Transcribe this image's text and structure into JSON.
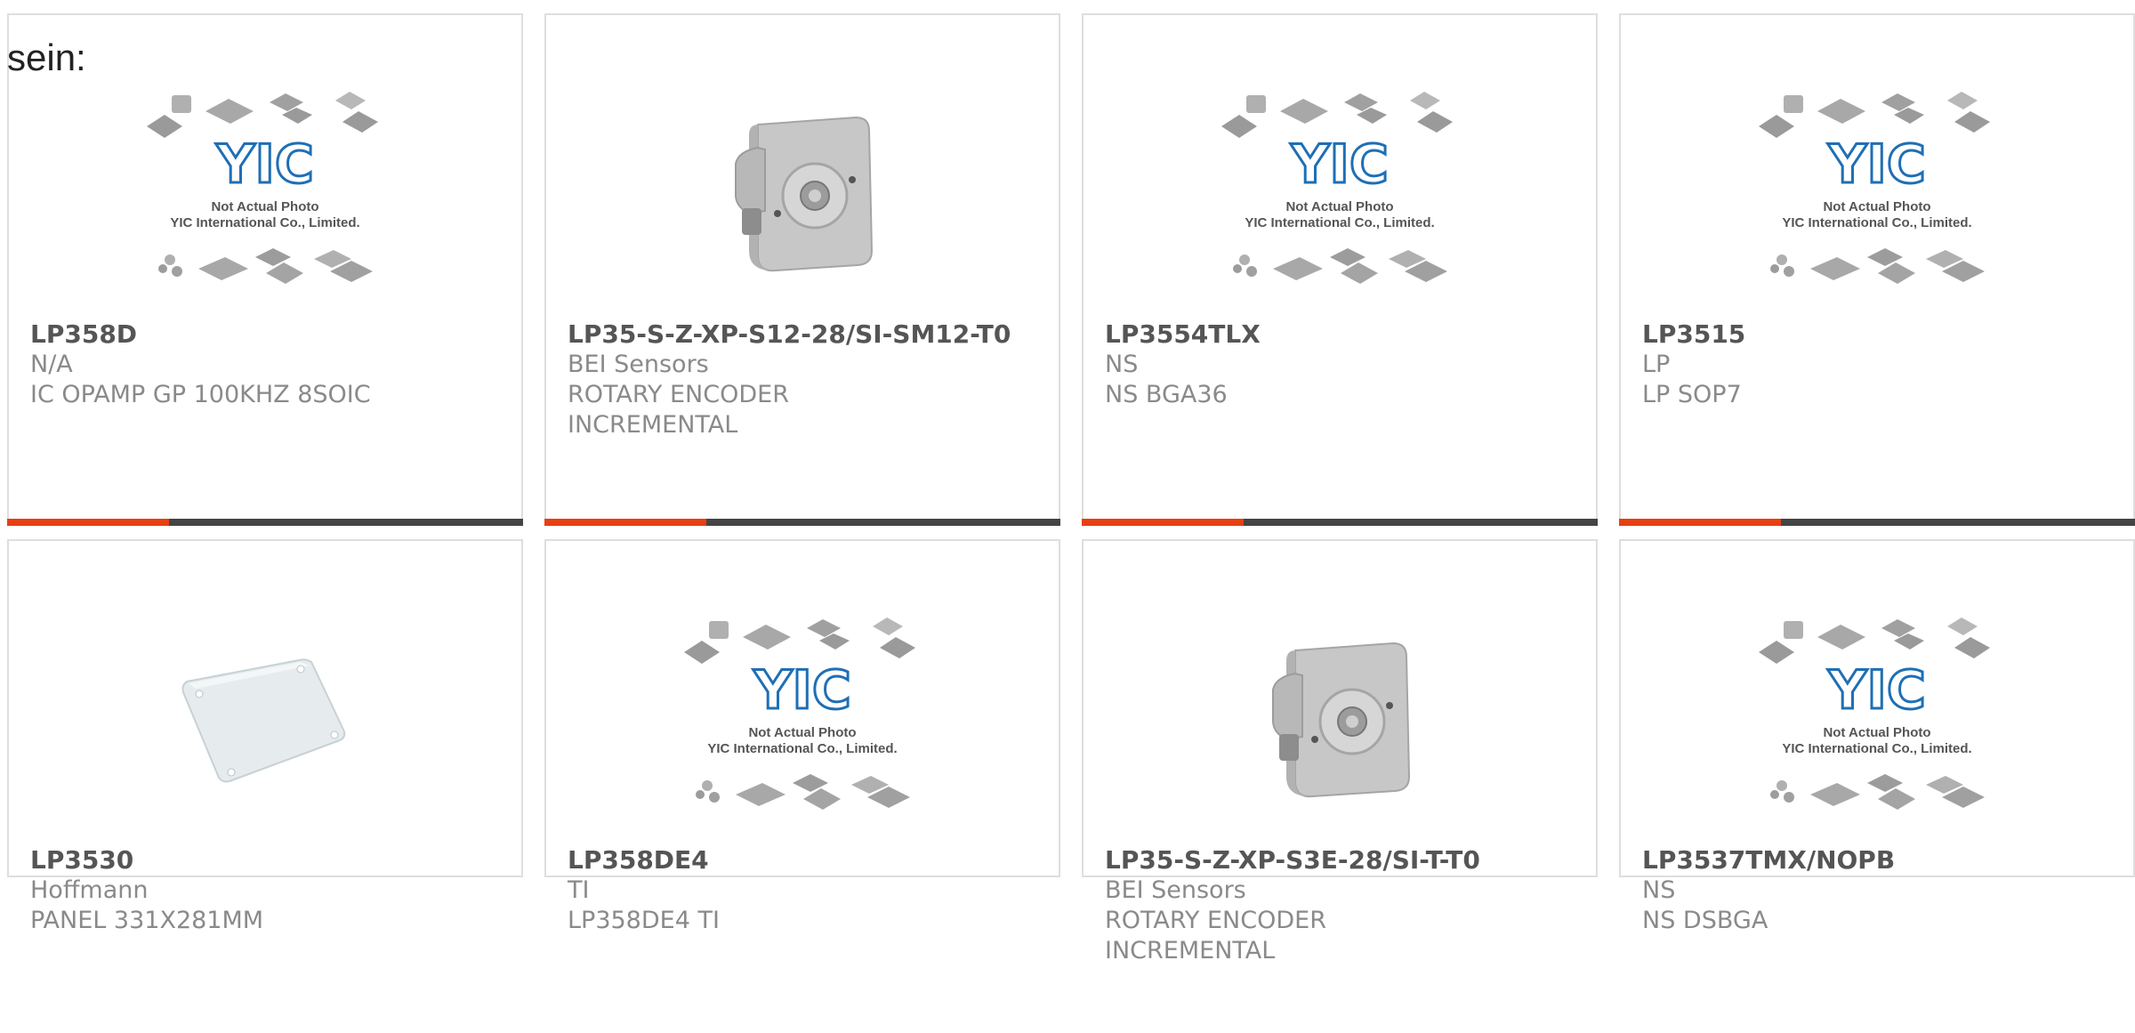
{
  "intro_text": "sein:",
  "colors": {
    "accent": "#e63f12",
    "bar": "#444444",
    "border": "#dedede",
    "part_number": "#555555",
    "secondary_text": "#8a8a8a",
    "logo_blue": "#1e6fb5"
  },
  "placeholder_image": {
    "line1": "Not Actual Photo",
    "line2": "YIC International Co., Limited.",
    "logo_text": "YIC"
  },
  "products": [
    {
      "part_number": "LP358D",
      "manufacturer": "N/A",
      "description": "IC OPAMP GP 100KHZ 8SOIC",
      "image": "placeholder"
    },
    {
      "part_number": "LP35-S-Z-XP-S12-28/SI-SM12-T0",
      "manufacturer": "BEI Sensors",
      "description": "ROTARY ENCODER INCREMENTAL",
      "image": "encoder"
    },
    {
      "part_number": "LP3554TLX",
      "manufacturer": "NS",
      "description": "NS BGA36",
      "image": "placeholder"
    },
    {
      "part_number": "LP3515",
      "manufacturer": "LP",
      "description": "LP SOP7",
      "image": "placeholder"
    },
    {
      "part_number": "LP3530",
      "manufacturer": "Hoffmann",
      "description": "PANEL 331X281MM",
      "image": "panel"
    },
    {
      "part_number": "LP358DE4",
      "manufacturer": "TI",
      "description": "LP358DE4 TI",
      "image": "placeholder"
    },
    {
      "part_number": "LP35-S-Z-XP-S3E-28/SI-T-T0",
      "manufacturer": "BEI Sensors",
      "description": "ROTARY ENCODER INCREMENTAL",
      "image": "encoder"
    },
    {
      "part_number": "LP3537TMX/NOPB",
      "manufacturer": "NS",
      "description": "NS DSBGA",
      "image": "placeholder"
    }
  ]
}
